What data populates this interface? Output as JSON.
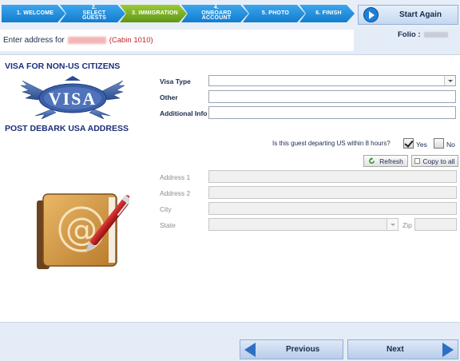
{
  "wizard": {
    "steps": [
      {
        "label": "1. Welcome"
      },
      {
        "label": "2. Select Guests"
      },
      {
        "label": "3. Immigration"
      },
      {
        "label": "4. Onboard Account"
      },
      {
        "label": "5. Photo"
      },
      {
        "label": "6. Finish"
      }
    ],
    "active_step_index": 2,
    "start_again_label": "Start Again"
  },
  "header": {
    "prefix": "Enter address for",
    "cabin": "(Cabin 1010)",
    "folio_label": "Folio :"
  },
  "visa": {
    "section_title": "VISA FOR NON-US CITIZENS",
    "logo_text": "VISA",
    "visa_type_label": "Visa Type",
    "visa_type_value": "",
    "other_label": "Other",
    "other_value": "",
    "additional_info_label": "Additional Info",
    "additional_info_value": ""
  },
  "address": {
    "section_title": "POST DEBARK USA ADDRESS",
    "departing_question": "Is this guest departing US within 8 hours?",
    "yes_label": "Yes",
    "yes_checked": true,
    "no_label": "No",
    "no_checked": false,
    "refresh_label": "Refresh",
    "copy_to_all_label": "Copy to all",
    "address1_label": "Address 1",
    "address2_label": "Address 2",
    "city_label": "City",
    "state_label": "State",
    "zip_label": "Zip"
  },
  "nav": {
    "previous_label": "Previous",
    "next_label": "Next"
  },
  "colors": {
    "step_blue": "#1e8ad9",
    "step_active_green": "#7db327",
    "section_title_navy": "#1c2e7a",
    "cabin_red": "#c0262d"
  }
}
